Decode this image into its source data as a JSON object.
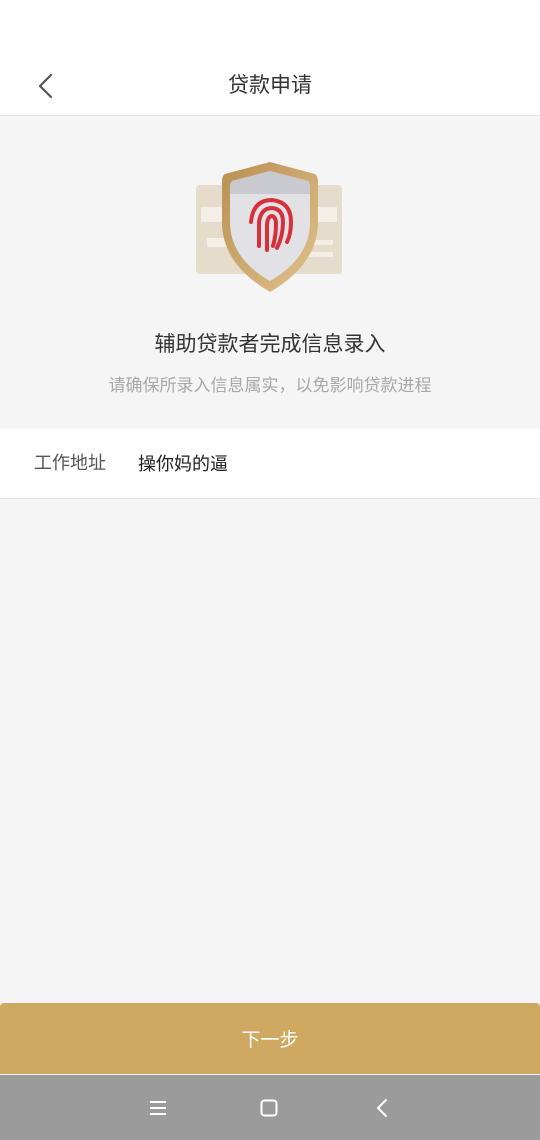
{
  "header": {
    "title": "贷款申请",
    "back_icon": "chevron-left-icon"
  },
  "hero": {
    "illustration_icon": "fingerprint-shield-icon",
    "title": "辅助贷款者完成信息录入",
    "subtitle": "请确保所录入信息属实，以免影响贷款进程"
  },
  "form": {
    "work_address": {
      "label": "工作地址",
      "value": "操你妈的逼"
    }
  },
  "actions": {
    "next_label": "下一步"
  },
  "system_nav": {
    "menu_icon": "menu-icon",
    "home_icon": "home-icon",
    "back_icon": "back-icon"
  },
  "colors": {
    "accent": "#cfa961",
    "fingerprint": "#d7303a",
    "nav_bar": "#9b9b9b",
    "background": "#f5f5f5"
  }
}
